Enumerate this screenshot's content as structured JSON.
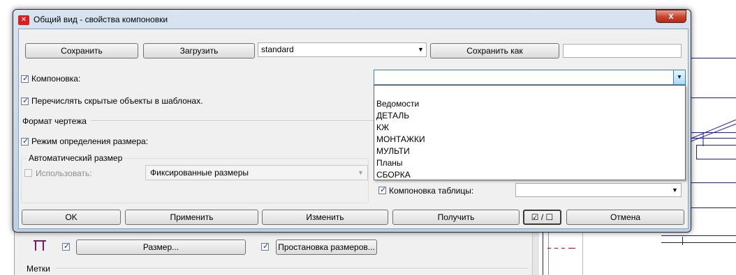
{
  "window": {
    "title": "Общий вид - свойства компоновки",
    "icon": "app-logo-icon",
    "close_symbol": "x"
  },
  "toolbar": {
    "save_label": "Сохранить",
    "load_label": "Загрузить",
    "preset_value": "standard",
    "save_as_label": "Сохранить как",
    "save_as_name_value": ""
  },
  "layout": {
    "checkbox_label": "Компоновка:",
    "checked": true,
    "combo_value": "",
    "dropdown_options": [
      "",
      "Ведомости",
      "ДЕТАЛЬ",
      "КЖ",
      "МОНТАЖКИ",
      "МУЛЬТИ",
      "Планы",
      "СБОРКА"
    ]
  },
  "hidden_objects": {
    "label": "Перечислять скрытые объекты в шаблонах.",
    "checked": true
  },
  "drawing_format": {
    "section_label": "Формат чертежа",
    "size_mode_label": "Режим определения размера:",
    "size_mode_checked": true,
    "auto_size_group_label": "Автоматический размер",
    "use_label": "Использовать:",
    "use_checked": false,
    "size_combo_value": "Фиксированные размеры"
  },
  "table_layout": {
    "label": "Компоновка таблицы:",
    "checked": true,
    "combo_value": ""
  },
  "footer": {
    "ok_label": "OK",
    "apply_label": "Применить",
    "modify_label": "Изменить",
    "get_label": "Получить",
    "toggle_label": "☑ / ☐",
    "cancel_label": "Отмена"
  },
  "background": {
    "size_label": "Размер...",
    "dimensioning_label": "Простановка размеров...",
    "marks_label": "Метки"
  },
  "colors": {
    "cad_line": "#1a1aa8",
    "close_button": "#c8442c",
    "title_gradient": "#bcd0e4"
  }
}
